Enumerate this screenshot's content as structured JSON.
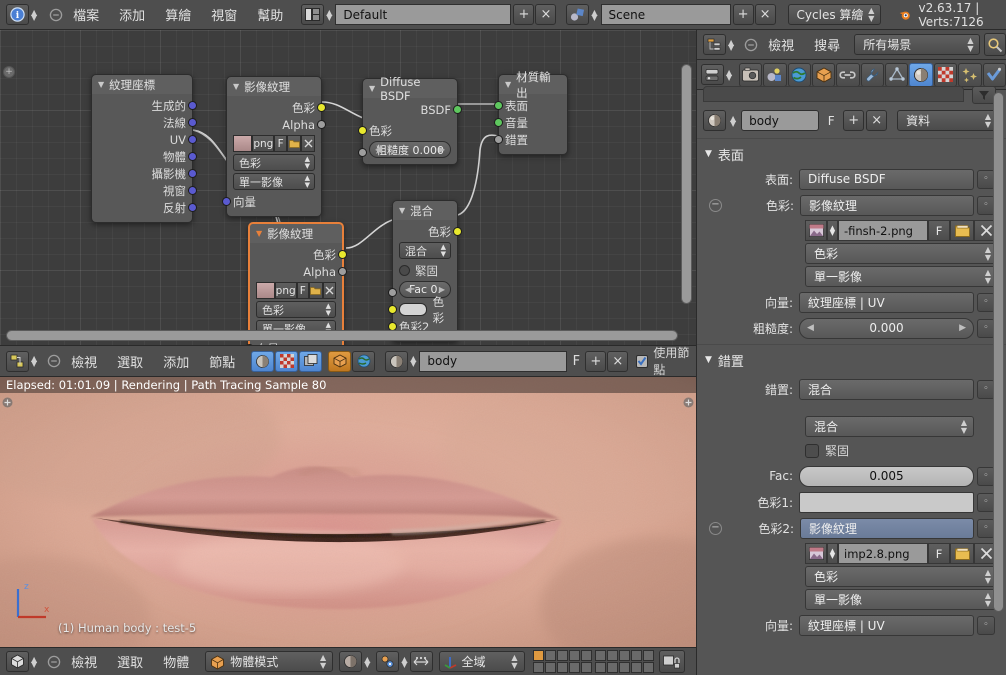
{
  "topbar": {
    "info_icon": "info-icon",
    "collapse_icon": "collapse-icon",
    "menus": [
      "檔案",
      "添加",
      "算繪",
      "視窗",
      "幫助"
    ],
    "screen_layout": "Default",
    "screen_add": "+",
    "screen_del": "×",
    "scene_name": "Scene",
    "scene_add": "+",
    "scene_del": "×",
    "render_engine": "Cycles 算繪",
    "version_info": "v2.63.17 | Verts:7126"
  },
  "node_editor": {
    "nodes": [
      {
        "title": "紋理座標",
        "outputs": [
          "生成的",
          "法線",
          "UV",
          "物體",
          "攝影機",
          "視窗",
          "反射"
        ]
      },
      {
        "title": "影像紋理",
        "outputs": [
          "色彩",
          "Alpha"
        ],
        "image_ext": "png",
        "fake_user": "F",
        "color_space": "色彩",
        "source": "單一影像",
        "input": "向量"
      },
      {
        "title": "Diffuse BSDF",
        "output": "BSDF",
        "color_input": "色彩",
        "roughness": "粗糙度  0.000"
      },
      {
        "title": "材質輸出",
        "inputs": [
          "表面",
          "音量",
          "錯置"
        ]
      },
      {
        "title": "影像紋理",
        "outputs": [
          "色彩",
          "Alpha"
        ],
        "image_ext": "png",
        "fake_user": "F",
        "color_space": "色彩",
        "source": "單一影像",
        "input": "向量",
        "selected": true
      },
      {
        "title": "混合",
        "output": "色彩",
        "blend_mode": "混合",
        "clamp": "緊固",
        "fac": "Fac 0.",
        "color1": "色彩",
        "color2": "色彩2"
      }
    ]
  },
  "node_header": {
    "editor_icon": "node-editor-icon",
    "collapse_icon": "collapse-icon",
    "menus": [
      "檢視",
      "選取",
      "添加",
      "節點"
    ],
    "shader_type_icons": [
      "material-icon",
      "texture-icon",
      "compositor-icon"
    ],
    "shader_target_icons": [
      "object-icon",
      "world-icon"
    ],
    "material_name": "body",
    "fake_user": "F",
    "add_btn": "+",
    "del_btn": "×",
    "use_nodes": "使用節點"
  },
  "viewport": {
    "render_status": "Elapsed: 01:01.09 | Rendering | Path Tracing Sample 80",
    "object_info": "(1) Human body : test-5",
    "axis_z": "z",
    "axis_x": "x"
  },
  "viewport_header": {
    "editor_icon": "3dview-icon",
    "collapse_icon": "collapse-icon",
    "menus": [
      "檢視",
      "選取",
      "物體"
    ],
    "mode": "物體模式",
    "shading_icon": "rendered-shading-icon",
    "pivot_icon": "pivot-icon",
    "snap_icon": "snap-icon",
    "transform_orientation": "全域",
    "layers_icon": "layers-widget",
    "lock_icon": "lock-icon"
  },
  "properties": {
    "outliner": {
      "editor_icon": "outliner-icon",
      "collapse_icon": "collapse-icon",
      "menus": [
        "檢視",
        "搜尋"
      ],
      "display_mode": "所有場景",
      "search_icon": "search-icon"
    },
    "tabs": [
      "render-icon",
      "scene-icon",
      "world-icon",
      "object-icon",
      "constraints-icon",
      "modifiers-icon",
      "data-icon",
      "material-icon",
      "texture-icon",
      "particles-icon",
      "physics-icon"
    ],
    "active_tab_index": 7,
    "material_name": "body",
    "fake_user": "F",
    "add_btn": "+",
    "del_btn": "×",
    "datablock_mode": "資料",
    "surface_panel": {
      "title": "表面",
      "rows": [
        {
          "label": "表面:",
          "value": "Diffuse BSDF"
        },
        {
          "label": "色彩:",
          "value": "影像紋理",
          "expandable": true
        }
      ],
      "image_file": "-finsh-2.png",
      "image_fake_user": "F",
      "open_icon": "open-folder-icon",
      "unlink_icon": "unlink-icon",
      "color_space": "色彩",
      "source": "單一影像",
      "vector_label": "向量:",
      "vector_value": "紋理座標 | UV",
      "roughness_label": "粗糙度:",
      "roughness_value": "0.000"
    },
    "displacement_panel": {
      "title": "錯置",
      "rows": [
        {
          "label": "錯置:",
          "value": "混合"
        }
      ],
      "blend_mode": "混合",
      "clamp_label": "緊固",
      "fac_label": "Fac:",
      "fac_value": "0.005",
      "color1_label": "色彩1:",
      "color2_label": "色彩2:",
      "color2_value": "影像紋理",
      "image_file": "imp2.8.png",
      "image_fake_user": "F",
      "color_space": "色彩",
      "source": "單一影像",
      "vector_label": "向量:",
      "vector_value": "紋理座標 | UV"
    }
  },
  "colors": {
    "accent_blue": "#5f93dd",
    "node_select_orange": "#e8803a",
    "socket_yellow": "#e8e82e",
    "socket_green": "#5ec75e",
    "socket_gray": "#9e9e9e",
    "socket_blue": "#5a5ad0",
    "header_bg": "#4e4e4e",
    "panel_bg": "#555555",
    "node_bg": "#585858"
  }
}
